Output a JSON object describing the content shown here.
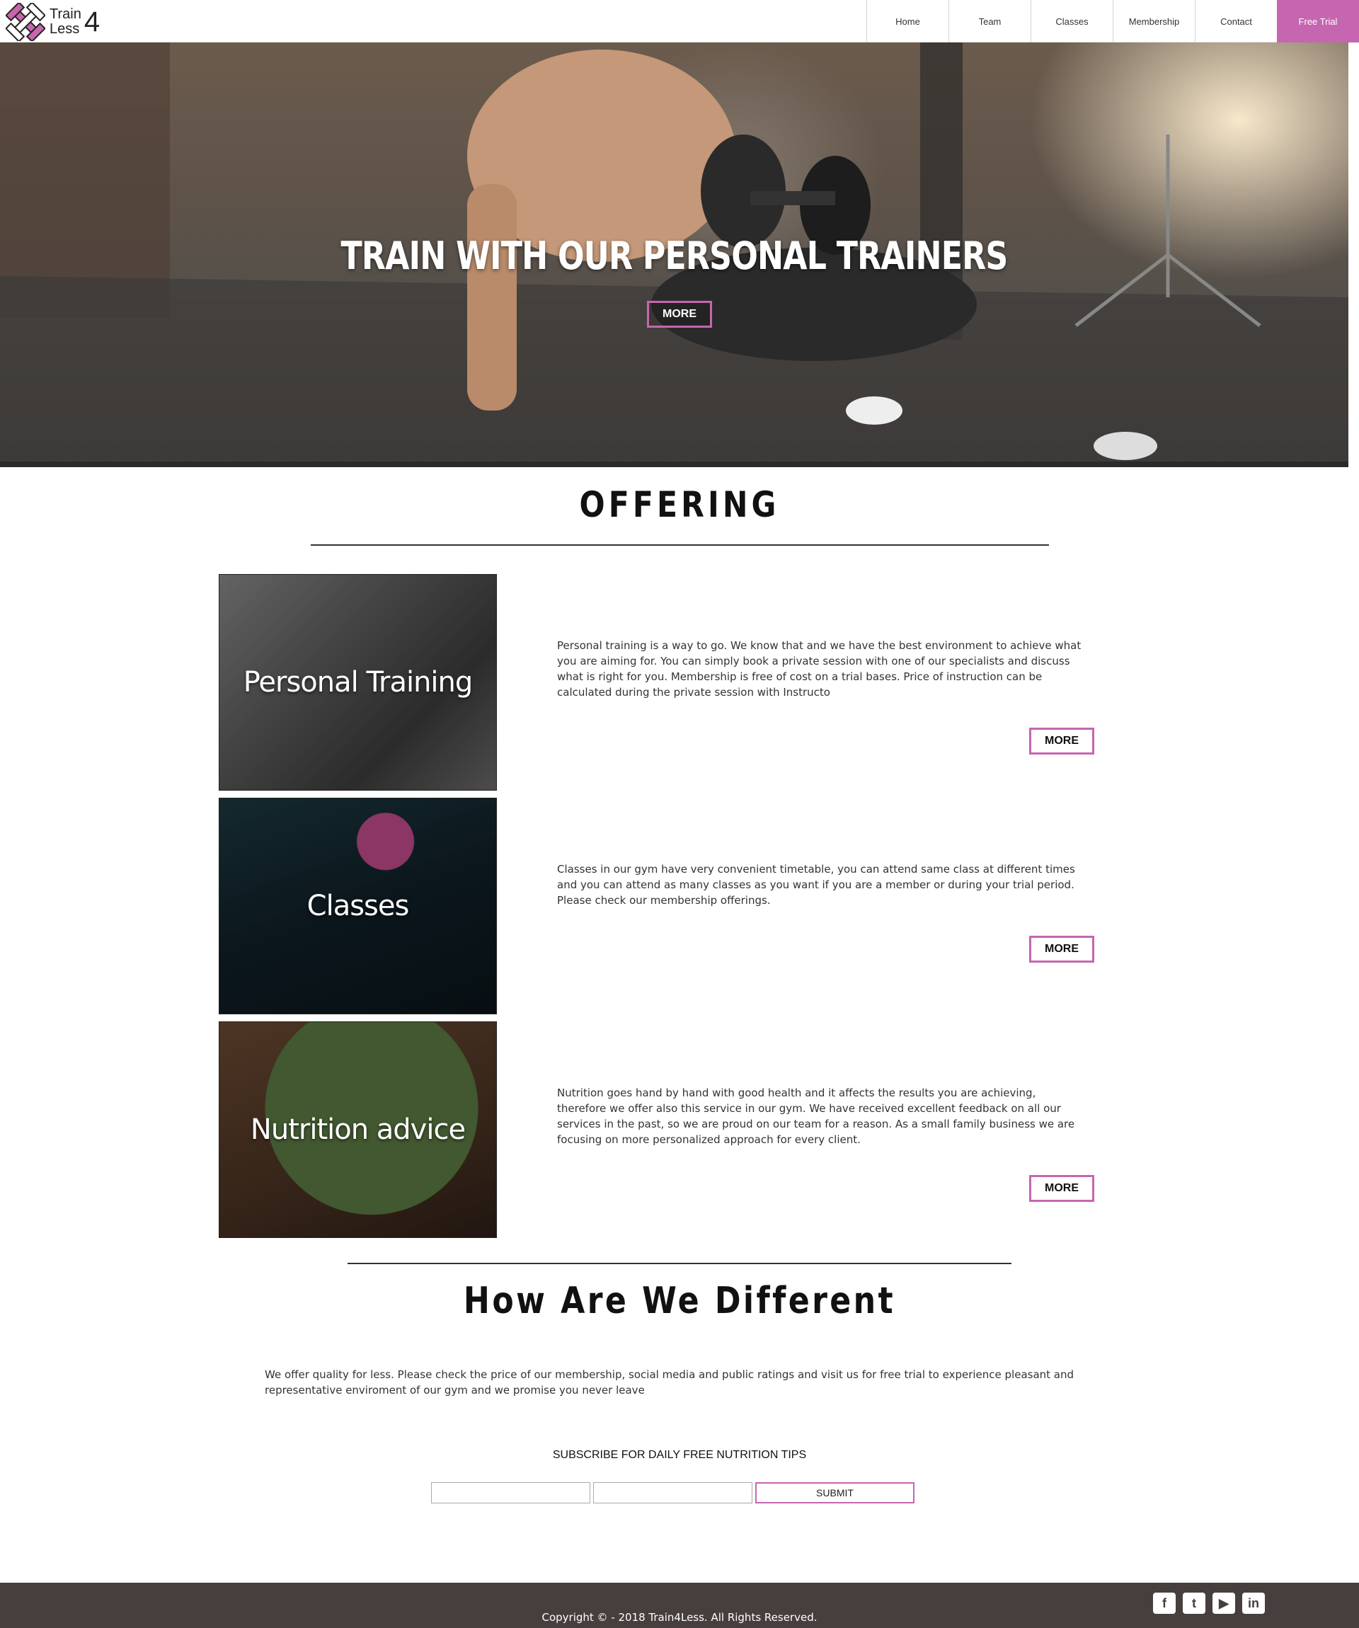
{
  "brand": {
    "line1": "Train",
    "line2": "Less",
    "number": "4",
    "accent": "#c666b0"
  },
  "nav": {
    "items": [
      {
        "label": "Home"
      },
      {
        "label": "Team"
      },
      {
        "label": "Classes"
      },
      {
        "label": "Membership"
      },
      {
        "label": "Contact"
      },
      {
        "label": "Free Trial"
      }
    ]
  },
  "hero": {
    "title": "TRAIN WITH OUR PERSONAL TRAINERS",
    "button": "MORE"
  },
  "offering": {
    "title": "OFFERING",
    "items": [
      {
        "label": "Personal Training",
        "text": "Personal training is a way to go. We know that and we have the best environment to achieve what you are aiming for. You can simply book a private session with one of our specialists and discuss what is right for you. Membership is free of cost on a trial bases. Price of instruction can be calculated during the private session with Instructo",
        "button": "MORE"
      },
      {
        "label": "Classes",
        "text": "Classes in our gym have very convenient timetable, you can attend same class at different times and you can attend as many classes as you want if you are a member or during your trial period. Please check our membership offerings.",
        "button": "MORE"
      },
      {
        "label": "Nutrition advice",
        "text": "Nutrition goes hand by hand with good health and it affects the results you are achieving, therefore we offer also this service in our gym. We have received excellent feedback on all our services in the past, so we are proud on our team for a reason. As a small family business we are focusing on more personalized approach for every client.",
        "button": "MORE"
      }
    ]
  },
  "different": {
    "title": "How Are We Different",
    "text": "We offer quality for less. Please check the price of our membership, social media and public ratings and visit us for free trial to experience pleasant and representative enviroment of our gym and we promise you never leave"
  },
  "subscribe": {
    "title": "SUBSCRIBE FOR DAILY FREE NUTRITION TIPS",
    "field1": "",
    "field2": "",
    "button": "SUBMIT"
  },
  "footer": {
    "copyright": "Copyright © - 2018 Train4Less. All Rights Reserved.",
    "social": [
      {
        "icon": "facebook-icon",
        "glyph": "f"
      },
      {
        "icon": "twitter-icon",
        "glyph": "t"
      },
      {
        "icon": "youtube-icon",
        "glyph": "▶"
      },
      {
        "icon": "linkedin-icon",
        "glyph": "in"
      }
    ]
  }
}
